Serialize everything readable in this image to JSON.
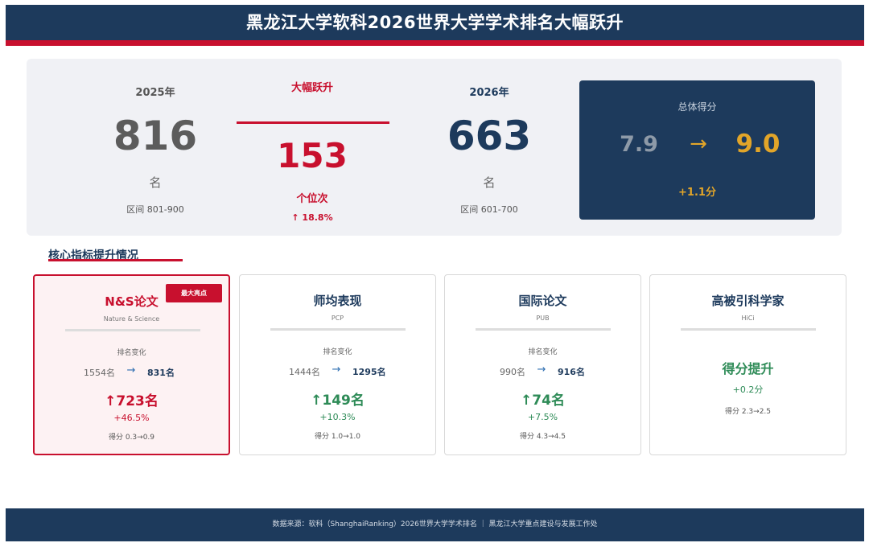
{
  "header": {
    "title": "黑龙江大学软科2026世界大学学术排名大幅跃升"
  },
  "summary": {
    "y2025": {
      "label": "2025年",
      "rank": "816",
      "unit": "名",
      "range": "区间 801-900"
    },
    "leap": {
      "label": "大幅跃升",
      "value": "153",
      "unit": "个位次",
      "pct": "↑ 18.8%"
    },
    "y2026": {
      "label": "2026年",
      "rank": "663",
      "unit": "名",
      "range": "区间 601-700"
    },
    "score": {
      "title": "总体得分",
      "old": "7.9",
      "arrow": "→",
      "new": "9.0",
      "delta": "+1.1分"
    }
  },
  "section": {
    "title": "核心指标提升情况"
  },
  "cards": [
    {
      "title": "N&S论文",
      "sub": "Nature & Science",
      "badge": "最大亮点",
      "change_label": "排名变化",
      "old": "1554名",
      "arrow": "→",
      "new": "831名",
      "up": "↑723名",
      "pct": "+46.5%",
      "score": "得分 0.3→0.9"
    },
    {
      "title": "师均表现",
      "sub": "PCP",
      "change_label": "排名变化",
      "old": "1444名",
      "arrow": "→",
      "new": "1295名",
      "up": "↑149名",
      "pct": "+10.3%",
      "score": "得分 1.0→1.0"
    },
    {
      "title": "国际论文",
      "sub": "PUB",
      "change_label": "排名变化",
      "old": "990名",
      "arrow": "→",
      "new": "916名",
      "up": "↑74名",
      "pct": "+7.5%",
      "score": "得分 4.3→4.5"
    },
    {
      "title": "高被引科学家",
      "sub": "HiCi",
      "big": "得分提升",
      "delta": "+0.2分",
      "score": "得分 2.3→2.5"
    }
  ],
  "footer": {
    "text": "数据来源：软科（ShanghaiRanking）2026世界大学学术排名 ｜ 黑龙江大学重点建设与发展工作处"
  },
  "colors": {
    "navy": "#1d3a5c",
    "red": "#c8102e",
    "gold": "#e2a529",
    "green": "#2e8b57"
  }
}
